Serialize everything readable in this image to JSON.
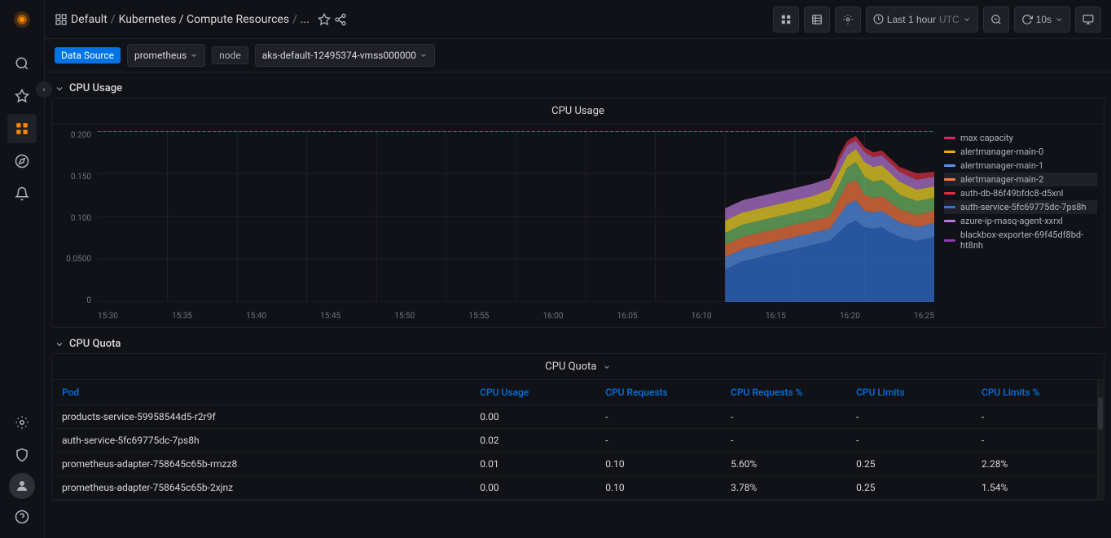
{
  "app": {
    "logo_icon": "grafana-logo"
  },
  "sidebar": {
    "expand_icon": "›",
    "items": [
      {
        "id": "search",
        "icon": "search-icon",
        "label": "Search",
        "active": false
      },
      {
        "id": "starred",
        "icon": "star-icon",
        "label": "Starred",
        "active": false
      },
      {
        "id": "dashboards",
        "icon": "dashboards-icon",
        "label": "Dashboards",
        "active": true
      },
      {
        "id": "explore",
        "icon": "explore-icon",
        "label": "Explore",
        "active": false
      },
      {
        "id": "alerting",
        "icon": "alert-icon",
        "label": "Alerting",
        "active": false
      }
    ],
    "bottom": [
      {
        "id": "config",
        "icon": "gear-icon",
        "label": "Configuration"
      },
      {
        "id": "shield",
        "icon": "shield-icon",
        "label": "Server Admin"
      },
      {
        "id": "avatar",
        "icon": "avatar-icon",
        "label": "Profile"
      },
      {
        "id": "help",
        "icon": "help-icon",
        "label": "Help"
      }
    ]
  },
  "header": {
    "breadcrumb": {
      "home_icon": "home-icon",
      "grid_icon": "grid-icon",
      "parts": [
        "Default",
        "Kubernetes / Compute Resources",
        "..."
      ]
    },
    "star_icon": "star-icon",
    "share_icon": "share-icon",
    "actions": {
      "viz_btn": "📊",
      "table_btn": "📄",
      "settings_btn": "⚙",
      "time_range": "Last 1 hour",
      "timezone": "UTC",
      "zoom_out_icon": "🔍",
      "refresh_icon": "↻",
      "refresh_rate": "10s",
      "monitor_icon": "🖥"
    }
  },
  "filter_bar": {
    "data_source_label": "Data Source",
    "prometheus_value": "prometheus",
    "node_tag": "node",
    "node_value": "aks-default-12495374-vmss000000"
  },
  "cpu_usage_section": {
    "title": "CPU Usage",
    "chart_title": "CPU Usage",
    "y_axis": [
      "0.200",
      "0.150",
      "0.100",
      "0.0500",
      "0"
    ],
    "x_axis": [
      "15:30",
      "15:35",
      "15:40",
      "15:45",
      "15:50",
      "15:55",
      "16:00",
      "16:05",
      "16:10",
      "16:15",
      "16:20",
      "16:25"
    ],
    "legend": [
      {
        "label": "max capacity",
        "color": "#e0226e"
      },
      {
        "label": "alertmanager-main-0",
        "color": "#f2a900"
      },
      {
        "label": "alertmanager-main-1",
        "color": "#5794f2"
      },
      {
        "label": "alertmanager-main-2",
        "color": "#ff7941"
      },
      {
        "label": "auth-db-86f49bfdc8-d5xnl",
        "color": "#e02f44"
      },
      {
        "label": "auth-service-5fc69775dc-7ps8h",
        "color": "#3274d9"
      },
      {
        "label": "azure-ip-masq-agent-xxrxl",
        "color": "#b877d9"
      },
      {
        "label": "blackbox-exporter-69f45df8bd-ht8nh",
        "color": "#8f3bb8"
      }
    ]
  },
  "cpu_quota_section": {
    "title": "CPU Quota",
    "table_title": "CPU Quota",
    "columns": [
      "Pod",
      "CPU Usage",
      "CPU Requests",
      "CPU Requests %",
      "CPU Limits",
      "CPU Limits %"
    ],
    "rows": [
      {
        "pod": "products-service-59958544d5-r2r9f",
        "cpu_usage": "0.00",
        "cpu_requests": "-",
        "cpu_requests_pct": "-",
        "cpu_limits": "-",
        "cpu_limits_pct": "-"
      },
      {
        "pod": "auth-service-5fc69775dc-7ps8h",
        "cpu_usage": "0.02",
        "cpu_requests": "-",
        "cpu_requests_pct": "-",
        "cpu_limits": "-",
        "cpu_limits_pct": "-"
      },
      {
        "pod": "prometheus-adapter-758645c65b-rmzz8",
        "cpu_usage": "0.01",
        "cpu_requests": "0.10",
        "cpu_requests_pct": "5.60%",
        "cpu_limits": "0.25",
        "cpu_limits_pct": "2.28%"
      },
      {
        "pod": "prometheus-adapter-758645c65b-2xjnz",
        "cpu_usage": "0.00",
        "cpu_requests": "0.10",
        "cpu_requests_pct": "3.78%",
        "cpu_limits": "0.25",
        "cpu_limits_pct": "1.54%"
      }
    ],
    "scrollbar_visible": true
  },
  "colors": {
    "accent_blue": "#0073e6",
    "background": "#111217",
    "panel_bg": "#181b1f",
    "border": "#1f2028",
    "text_primary": "#d8d9da",
    "text_secondary": "#adb5bd",
    "text_muted": "#6c757d"
  }
}
